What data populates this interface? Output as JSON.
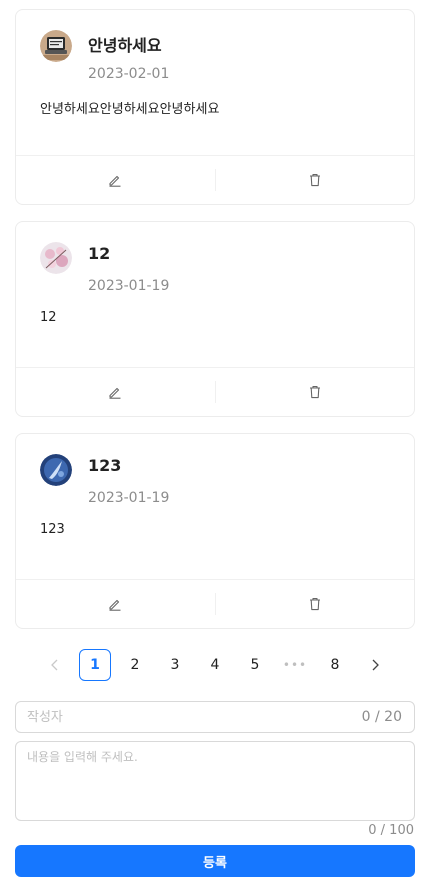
{
  "posts": [
    {
      "title": "안녕하세요",
      "date": "2023-02-01",
      "content": "안녕하세요안녕하세요안녕하세요",
      "avatar": "laptop-photo"
    },
    {
      "title": "12",
      "date": "2023-01-19",
      "content": "12",
      "avatar": "blossom-photo"
    },
    {
      "title": "123",
      "date": "2023-01-19",
      "content": "123",
      "avatar": "blue-sky-photo"
    }
  ],
  "actions": {
    "edit_icon": "edit-icon",
    "delete_icon": "trash-icon"
  },
  "pagination": {
    "prev_icon": "chevron-left-icon",
    "next_icon": "chevron-right-icon",
    "pages": [
      "1",
      "2",
      "3",
      "4",
      "5",
      "•••",
      "8"
    ],
    "current": "1"
  },
  "form": {
    "author_placeholder": "작성자",
    "author_value": "",
    "author_count": "0 / 20",
    "content_placeholder": "내용을 입력해 주세요.",
    "content_value": "",
    "content_count": "0 / 100",
    "submit_label": "등록"
  },
  "colors": {
    "primary": "#1677ff",
    "muted": "#8c8c8c",
    "border": "#d9d9d9"
  }
}
